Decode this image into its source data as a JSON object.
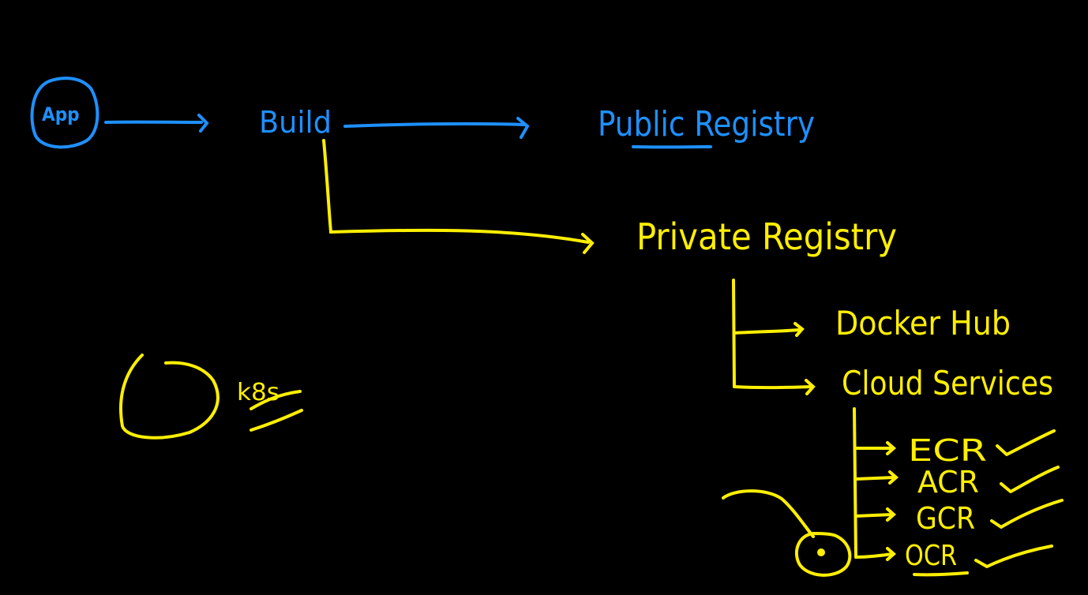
{
  "canvas": {
    "background": "#000000"
  },
  "colors": {
    "blue": "#1e90ff",
    "yellow": "#ffef00"
  },
  "nodes": {
    "app": "App",
    "build": "Build",
    "public_registry": "Public Registry",
    "private_registry": "Private Registry",
    "docker_hub": "Docker Hub",
    "cloud_services": "Cloud Services",
    "ecr": "ECR",
    "acr": "ACR",
    "gcr": "GCR",
    "ocr": "OCR",
    "k8s": "k8s"
  },
  "marks": {
    "check": "check-icon"
  }
}
